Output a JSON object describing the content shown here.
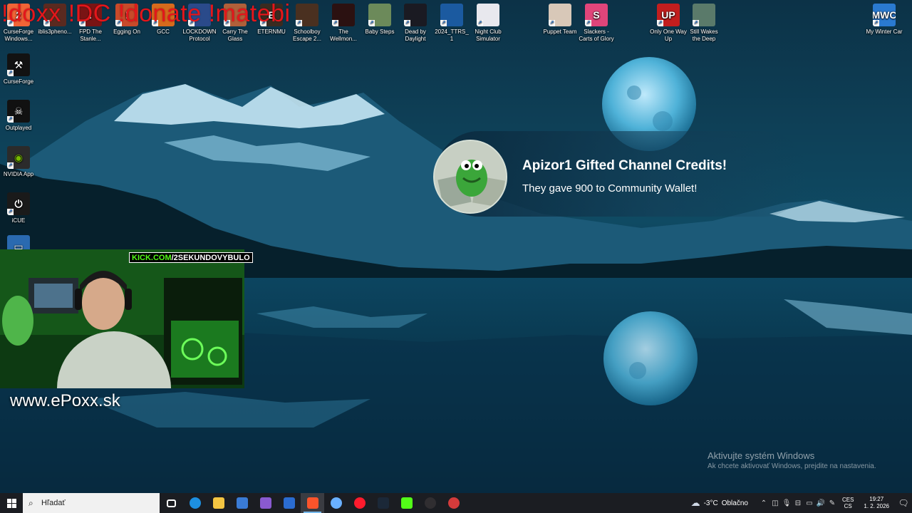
{
  "overlay": {
    "commands": "!doxx !DC !donate !matebi"
  },
  "desktop": {
    "top_icons": [
      {
        "label": "CurseForge Windows...",
        "color": "#f16436",
        "glyph": "2"
      },
      {
        "label": "iblis3pheno...",
        "color": "#5a2a20",
        "glyph": ""
      },
      {
        "label": "FPD The Stanle...",
        "color": "#7a1414",
        "glyph": "!"
      },
      {
        "label": "Egging On",
        "color": "#c84a2a",
        "glyph": "!"
      },
      {
        "label": "GCC",
        "color": "#d66a1c",
        "glyph": ""
      },
      {
        "label": "LOCKDOWN Protocol",
        "color": "#2a4a8a",
        "glyph": ""
      },
      {
        "label": "Carry The Glass",
        "color": "#b0603a",
        "glyph": ""
      },
      {
        "label": "ETERNMU",
        "color": "#3a2b20",
        "glyph": "E"
      },
      {
        "label": "Schoolboy Escape 2...",
        "color": "#4a3020",
        "glyph": ""
      },
      {
        "label": "The Wellmon...",
        "color": "#2b1111",
        "glyph": ""
      },
      {
        "label": "Baby Steps",
        "color": "#6c8a5a",
        "glyph": ""
      },
      {
        "label": "Dead by Daylight",
        "color": "#1a1a22",
        "glyph": ""
      },
      {
        "label": "2024_TTRS_1",
        "color": "#1b5aa0",
        "glyph": ""
      },
      {
        "label": "Night Club Simulator",
        "color": "#e8e8ee",
        "glyph": ""
      },
      {
        "label": "Puppet Team",
        "color": "#d8c8b8",
        "glyph": ""
      },
      {
        "label": "Slackers - Carts of Glory",
        "color": "#e0457a",
        "glyph": "S"
      },
      {
        "label": "Only One Way Up",
        "color": "#c21e1e",
        "glyph": "UP"
      },
      {
        "label": "Still Wakes the Deep",
        "color": "#5a7a6a",
        "glyph": ""
      },
      {
        "label": "My Winter Car",
        "color": "#2a7ad0",
        "glyph": "MWC"
      }
    ],
    "left_icons": [
      {
        "label": "CurseForge",
        "color": "#121212",
        "glyph": "⚒"
      },
      {
        "label": "Outplayed",
        "color": "#111111",
        "glyph": "☠"
      },
      {
        "label": "NVIDIA App",
        "color": "#2b2b2b",
        "glyph": "◉"
      },
      {
        "label": "iCUE",
        "color": "#1a1a1a",
        "glyph": "⏻"
      },
      {
        "label": "",
        "color": "#2a6ab0",
        "glyph": "▭"
      }
    ]
  },
  "notification": {
    "title": "Apizor1 Gifted Channel Credits!",
    "subtitle": "They gave 900 to Community Wallet!"
  },
  "webcam": {
    "kick_prefix": "KICK.COM",
    "kick_channel": "/2SEKUNDOVYBULO"
  },
  "site_url": "www.ePoxx.sk",
  "activation": {
    "title": "Aktivujte systém Windows",
    "subtitle": "Ak chcete aktivovať Windows, prejdite na nastavenia."
  },
  "taskbar": {
    "search_placeholder": "Hľadať",
    "apps": [
      {
        "name": "task-view",
        "color": "#ffffff",
        "active": false
      },
      {
        "name": "edge",
        "color": "#1d8fe0",
        "active": false
      },
      {
        "name": "file-explorer",
        "color": "#f4c542",
        "active": false
      },
      {
        "name": "store",
        "color": "#3a7bd5",
        "active": false
      },
      {
        "name": "copilot",
        "color": "#8a5ad0",
        "active": false
      },
      {
        "name": "mail",
        "color": "#2b6cd0",
        "active": false
      },
      {
        "name": "brave",
        "color": "#fb542b",
        "active": true
      },
      {
        "name": "app-blue",
        "color": "#6ab0ff",
        "active": false
      },
      {
        "name": "opera",
        "color": "#ff1b2d",
        "active": false
      },
      {
        "name": "steam",
        "color": "#1b2838",
        "active": false
      },
      {
        "name": "kick",
        "color": "#53fc18",
        "active": false
      },
      {
        "name": "obs",
        "color": "#302e31",
        "active": false
      },
      {
        "name": "app-red",
        "color": "#d43b3b",
        "active": false
      }
    ],
    "weather": {
      "temp": "-3°C",
      "condition": "Oblačno"
    },
    "lang": {
      "line1": "CES",
      "line2": "CS"
    },
    "clock": {
      "time": "19:27",
      "date": "1. 2. 2026"
    }
  }
}
